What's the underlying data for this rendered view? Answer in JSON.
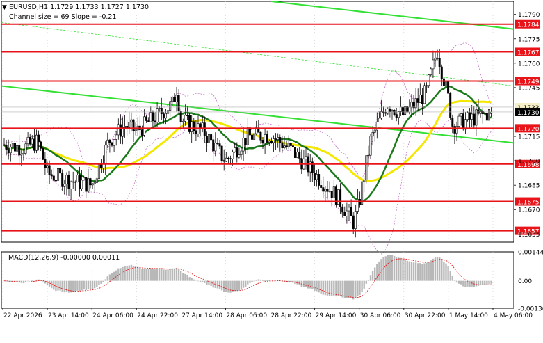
{
  "header": {
    "symbol_line": "EURUSD,H1  1.1729 1.1733 1.1727 1.1730",
    "channel_line": "Channel size = 69 Slope = -0.21"
  },
  "macd": {
    "label": "MACD(12,26,9) -0.00000 0.00011",
    "ticks": [
      "0.00144",
      "0.00",
      "-0.00136"
    ]
  },
  "price_axis": {
    "ticks": [
      "1.1790",
      "1.1775",
      "1.1760",
      "1.1745",
      "1.1715",
      "1.1700",
      "1.1685",
      "1.1670",
      "1.1655"
    ]
  },
  "levels": [
    {
      "label": "1.1784",
      "value": 1.1784
    },
    {
      "label": "1.1767",
      "value": 1.1767
    },
    {
      "label": "1.1749",
      "value": 1.1749
    },
    {
      "label": "1.1720",
      "value": 1.172
    },
    {
      "label": "1.1698",
      "value": 1.1698
    },
    {
      "label": "1.1675",
      "value": 1.1675
    },
    {
      "label": "1.1657",
      "value": 1.1657
    }
  ],
  "markers": [
    {
      "label": "1.1733",
      "value": 1.1733,
      "color": "#f5f0c8",
      "text_color": "#000000"
    },
    {
      "label": "1.1730",
      "value": 1.173,
      "color": "#000000",
      "text_color": "#ffffff"
    }
  ],
  "time_axis": [
    "22 Apr 2026",
    "23 Apr 14:00",
    "24 Apr 06:00",
    "24 Apr 22:00",
    "27 Apr 14:00",
    "28 Apr 06:00",
    "28 Apr 22:00",
    "29 Apr 14:00",
    "30 Apr 06:00",
    "30 Apr 22:00",
    "1 May 14:00",
    "4 May 06:00"
  ],
  "colors": {
    "level_line": "#e8141a",
    "level_label_bg": "#e8141a",
    "green_channel": "#33e033",
    "ma_fast": "#1a7a1a",
    "ma_slow": "#f5e800",
    "bollinger": "#c060c0",
    "candle_up": "#ffffff",
    "candle_down": "#000000",
    "macd_hist": "#b8b8b8",
    "macd_signal": "#e02020"
  },
  "chart_data": {
    "type": "candlestick",
    "symbol": "EURUSD",
    "timeframe": "H1",
    "last_bar": {
      "open": 1.1729,
      "high": 1.1733,
      "low": 1.1727,
      "close": 1.173
    },
    "channel_size": 69,
    "slope": -0.21,
    "ylim": [
      1.165,
      1.1798
    ],
    "close_path": [
      {
        "x": "22 Apr 2026",
        "y": 1.171
      },
      {
        "x": "22 Apr 18:00",
        "y": 1.1708
      },
      {
        "x": "23 Apr 06:00",
        "y": 1.1712
      },
      {
        "x": "23 Apr 14:00",
        "y": 1.1692
      },
      {
        "x": "23 Apr 22:00",
        "y": 1.1688
      },
      {
        "x": "24 Apr 06:00",
        "y": 1.1685
      },
      {
        "x": "24 Apr 12:00",
        "y": 1.1712
      },
      {
        "x": "24 Apr 18:00",
        "y": 1.1722
      },
      {
        "x": "24 Apr 22:00",
        "y": 1.1718
      },
      {
        "x": "27 Apr 02:00",
        "y": 1.1735
      },
      {
        "x": "27 Apr 08:00",
        "y": 1.1745
      },
      {
        "x": "27 Apr 14:00",
        "y": 1.1725
      },
      {
        "x": "27 Apr 22:00",
        "y": 1.1718
      },
      {
        "x": "28 Apr 06:00",
        "y": 1.17
      },
      {
        "x": "28 Apr 14:00",
        "y": 1.1715
      },
      {
        "x": "28 Apr 22:00",
        "y": 1.1716
      },
      {
        "x": "29 Apr 06:00",
        "y": 1.1706
      },
      {
        "x": "29 Apr 14:00",
        "y": 1.1692
      },
      {
        "x": "29 Apr 22:00",
        "y": 1.1678
      },
      {
        "x": "30 Apr 04:00",
        "y": 1.1662
      },
      {
        "x": "30 Apr 06:00",
        "y": 1.1675
      },
      {
        "x": "30 Apr 10:00",
        "y": 1.1712
      },
      {
        "x": "30 Apr 16:00",
        "y": 1.1735
      },
      {
        "x": "30 Apr 22:00",
        "y": 1.1728
      },
      {
        "x": "1 May 06:00",
        "y": 1.1742
      },
      {
        "x": "1 May 10:00",
        "y": 1.1768
      },
      {
        "x": "1 May 14:00",
        "y": 1.1738
      },
      {
        "x": "1 May 20:00",
        "y": 1.1722
      },
      {
        "x": "4 May 06:00",
        "y": 1.173
      }
    ],
    "indicators": {
      "ma_fast_color": "green",
      "ma_slow_color": "yellow",
      "bollinger": true,
      "macd": {
        "fast": 12,
        "slow": 26,
        "signal": 9,
        "main": -0.0,
        "signal_value": 0.00011
      }
    }
  }
}
